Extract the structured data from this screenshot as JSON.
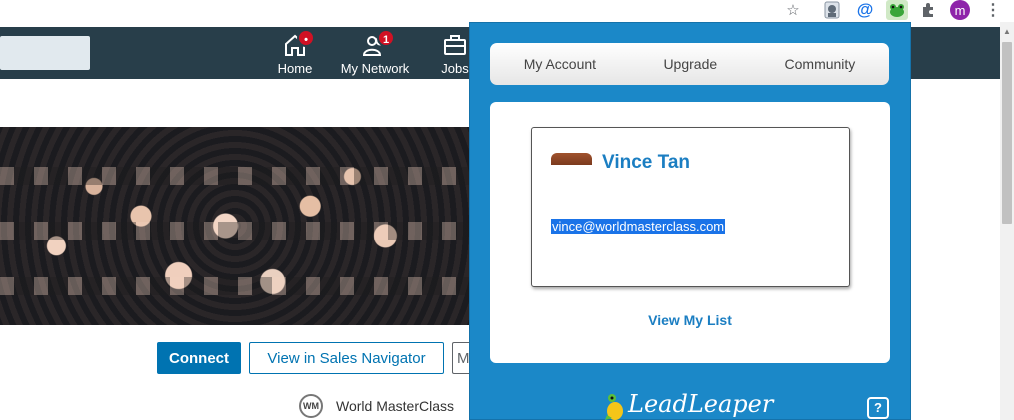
{
  "browser": {
    "extensions": [
      {
        "name": "bookmark-star",
        "glyph": "☆"
      },
      {
        "name": "ghost-extension"
      },
      {
        "name": "at-extension",
        "glyph": "@"
      },
      {
        "name": "leadleaper-frog-extension"
      },
      {
        "name": "extensions-puzzle"
      }
    ],
    "profile_initial": "m",
    "menu_glyph": "⋮"
  },
  "linkedin": {
    "nav": {
      "home_label": "Home",
      "network_label": "My Network",
      "network_badge": "1",
      "jobs_label": "Jobs"
    },
    "profile": {
      "connect_label": "Connect",
      "sales_navigator_label": "View in Sales Navigator",
      "more_label": "M",
      "company_logo_text": "WM",
      "company_name": "World MasterClass"
    }
  },
  "leadleaper": {
    "tabs": [
      "My Account",
      "Upgrade",
      "Community"
    ],
    "contact": {
      "name": "Vince Tan",
      "email": "vince@worldmasterclass.com"
    },
    "view_list_label": "View My List",
    "brand_name": "LeadLeaper",
    "help_label": "?"
  },
  "colors": {
    "linkedin_nav": "#283e4a",
    "linkedin_blue": "#0073b1",
    "popup_blue": "#1b88c8",
    "contact_blue": "#1b7ec2",
    "badge_red": "#d11124",
    "selection_blue": "#1a73e8"
  }
}
